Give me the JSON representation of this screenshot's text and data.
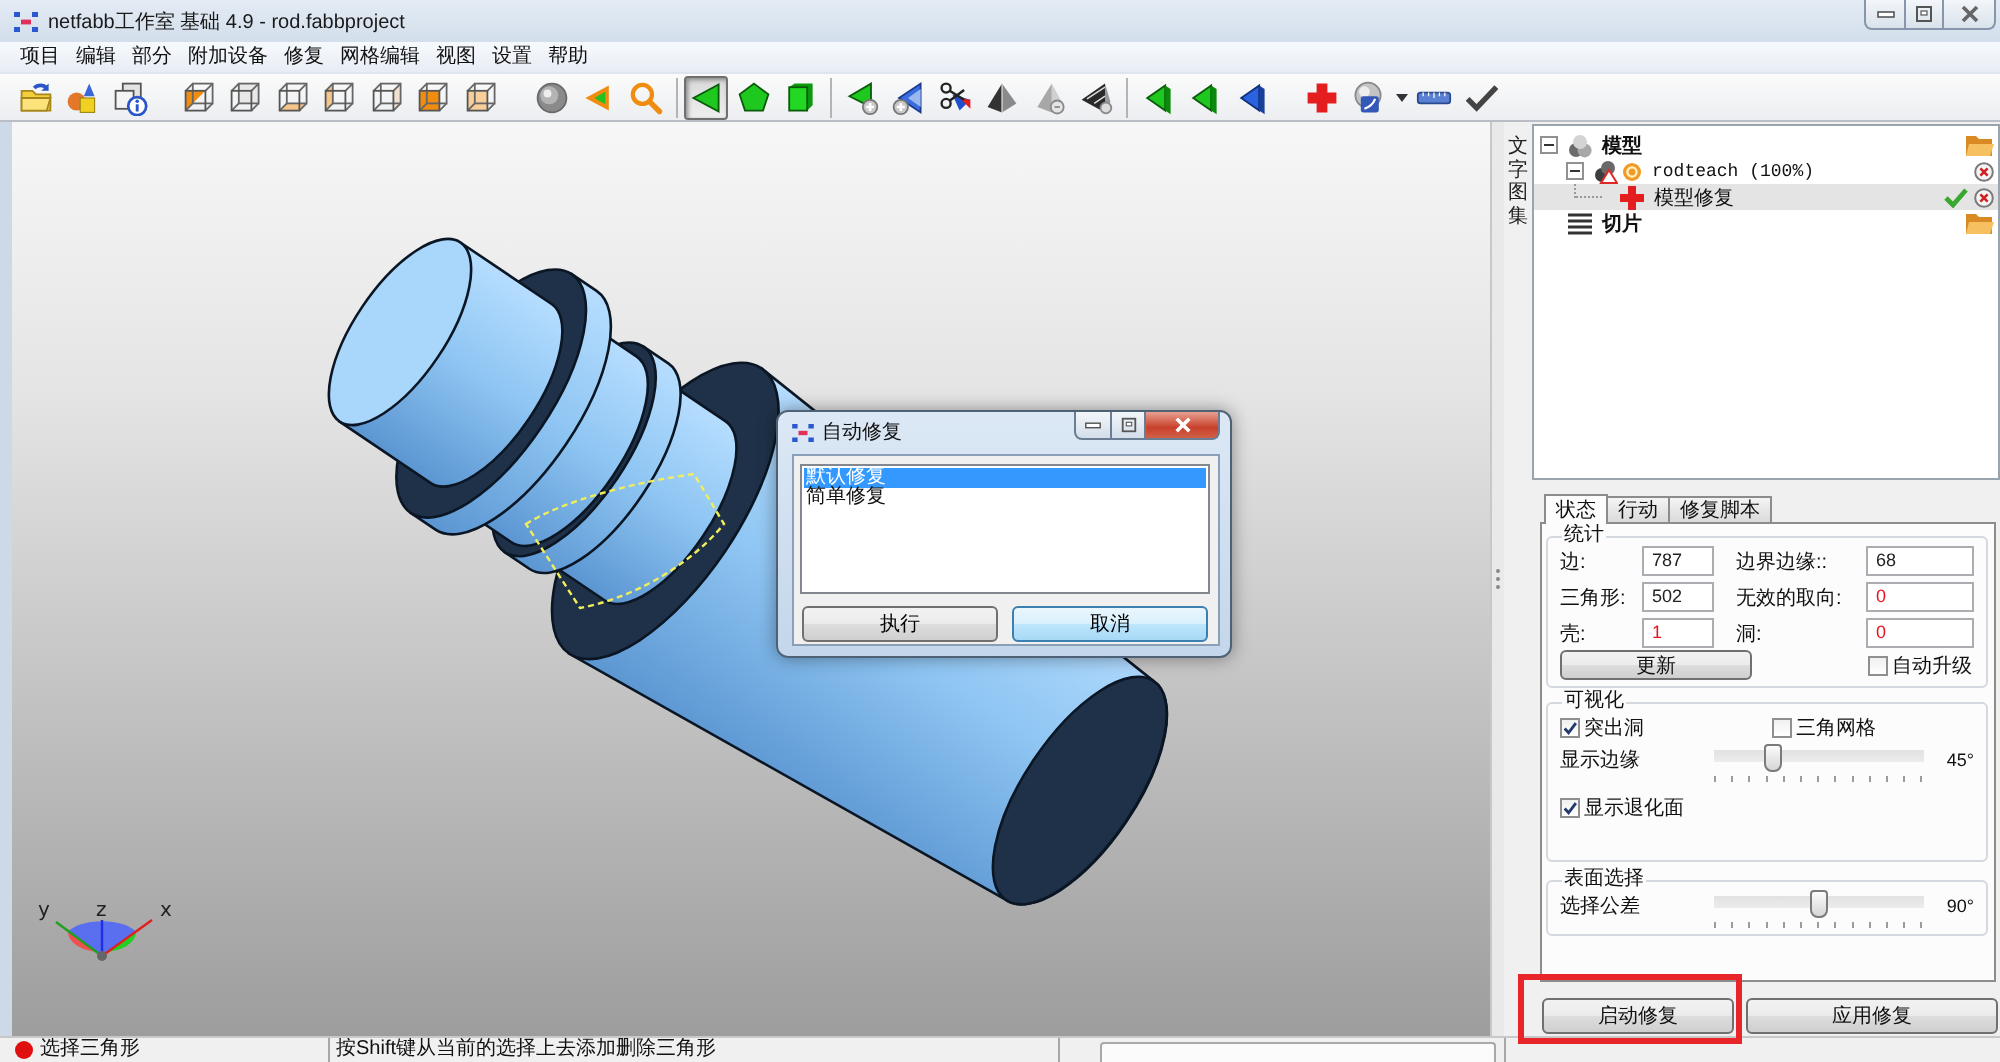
{
  "window": {
    "title": "netfabb工作室 基础 4.9 - rod.fabbproject"
  },
  "menu": [
    "项目",
    "编辑",
    "部分",
    "附加设备",
    "修复",
    "网格编辑",
    "视图",
    "设置",
    "帮助"
  ],
  "toolbar": [
    {
      "kind": "folder",
      "selected": false
    },
    {
      "kind": "shapes",
      "selected": false
    },
    {
      "kind": "info",
      "selected": false
    },
    {
      "kind": "gap"
    },
    {
      "kind": "cubehalf",
      "selected": false
    },
    {
      "kind": "cubeback",
      "selected": false
    },
    {
      "kind": "cubebottom",
      "selected": false
    },
    {
      "kind": "cubeleft",
      "selected": false
    },
    {
      "kind": "cuberight",
      "selected": false
    },
    {
      "kind": "cubefull",
      "selected": false
    },
    {
      "kind": "cubefront",
      "selected": false
    },
    {
      "kind": "gap"
    },
    {
      "kind": "sphere",
      "selected": false
    },
    {
      "kind": "pointer",
      "selected": false
    },
    {
      "kind": "magnifier",
      "selected": false
    },
    {
      "kind": "separator"
    },
    {
      "kind": "triangle",
      "selected": true
    },
    {
      "kind": "pentagon",
      "selected": false
    },
    {
      "kind": "shell",
      "selected": false
    },
    {
      "kind": "separator"
    },
    {
      "kind": "triplus",
      "selected": false
    },
    {
      "kind": "triplusblue",
      "selected": false
    },
    {
      "kind": "scissors",
      "selected": false
    },
    {
      "kind": "pyramid",
      "selected": false
    },
    {
      "kind": "pyramidgray",
      "selected": false
    },
    {
      "kind": "pyramidlayers",
      "selected": false
    },
    {
      "kind": "separator"
    },
    {
      "kind": "greentri",
      "selected": false
    },
    {
      "kind": "greentri",
      "selected": false
    },
    {
      "kind": "bluetri",
      "selected": false
    },
    {
      "kind": "gap"
    },
    {
      "kind": "cross",
      "selected": false
    },
    {
      "kind": "gauge",
      "selected": false
    },
    {
      "kind": "caret",
      "selected": false
    },
    {
      "kind": "ruler",
      "selected": false
    },
    {
      "kind": "check",
      "selected": false
    }
  ],
  "viewport": {
    "axis_gizmo": {
      "x_label": "x",
      "y_label": "y",
      "z_label": "z"
    }
  },
  "dialog": {
    "title": "自动修复",
    "options": [
      {
        "label": "默认修复",
        "selected": true
      },
      {
        "label": "简单修复",
        "selected": false
      }
    ],
    "buttons": [
      {
        "label": "执行",
        "focused": false
      },
      {
        "label": "取消",
        "focused": true
      }
    ]
  },
  "side_tab": "文字图集",
  "tree": [
    {
      "label": "模型",
      "kind": "models",
      "expanded": true,
      "selected": false,
      "actions": [
        {
          "kind": "folder"
        }
      ],
      "children": [
        {
          "label": "rodteach (100%)",
          "kind": "part",
          "expanded": true,
          "selected": false,
          "actions": [
            {
              "kind": "remove"
            }
          ],
          "children": [
            {
              "label": "模型修复",
              "kind": "repair",
              "selected": true,
              "actions": [
                {
                  "kind": "apply"
                },
                {
                  "kind": "remove"
                }
              ]
            }
          ]
        }
      ]
    },
    {
      "label": "切片",
      "kind": "slices",
      "selected": false,
      "actions": [
        {
          "kind": "folder"
        }
      ]
    }
  ],
  "tabs": [
    {
      "label": "状态",
      "selected": true
    },
    {
      "label": "行动",
      "selected": false
    },
    {
      "label": "修复脚本",
      "selected": false
    }
  ],
  "statistics": {
    "title": "统计",
    "fields": [
      {
        "label": "边:",
        "value": "787",
        "alert": false
      },
      {
        "label": "边界边缘::",
        "value": "68",
        "alert": false
      },
      {
        "label": "三角形:",
        "value": "502",
        "alert": false
      },
      {
        "label": "无效的取向:",
        "value": "0",
        "alert": true
      },
      {
        "label": "壳:",
        "value": "1",
        "alert": true
      },
      {
        "label": "洞:",
        "value": "0",
        "alert": true
      }
    ],
    "update_button": "更新",
    "auto_update": {
      "label": "自动升级",
      "checked": false
    }
  },
  "visualization": {
    "title": "可视化",
    "highlight_holes": {
      "label": "突出洞",
      "checked": true
    },
    "triangle_mesh": {
      "label": "三角网格",
      "checked": false
    },
    "show_edges": {
      "label": "显示边缘",
      "level": 0.26,
      "reading": "45°"
    },
    "degenerate_faces": {
      "label": "显示退化面",
      "checked": true
    }
  },
  "surface_selection": {
    "title": "表面选择",
    "tolerance": {
      "label": "选择公差",
      "level": 0.5,
      "reading": "90°"
    }
  },
  "actions": [
    {
      "label": "启动修复",
      "highlighted": true
    },
    {
      "label": "应用修复",
      "highlighted": false
    }
  ],
  "status_bar": {
    "message": "选择三角形",
    "hint": "按Shift键从当前的选择上去添加删除三角形"
  }
}
